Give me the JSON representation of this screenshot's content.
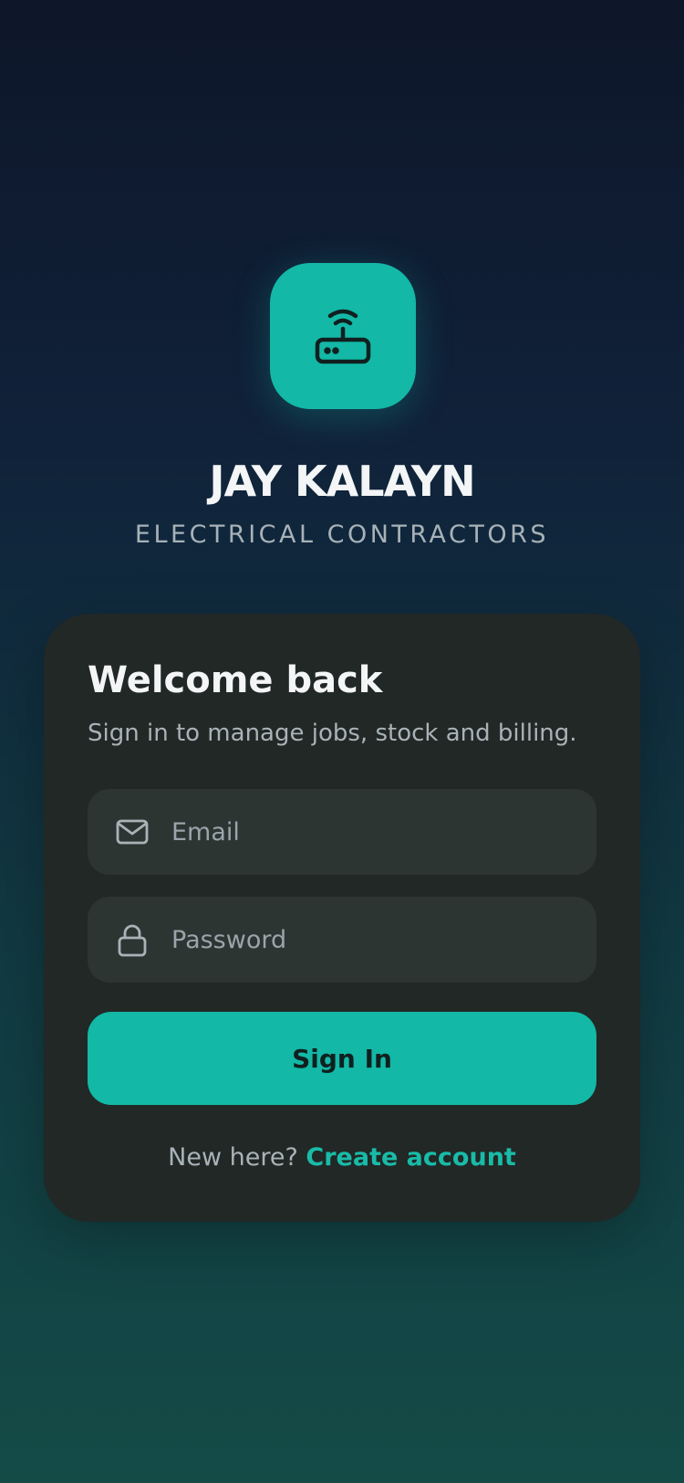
{
  "brand": {
    "logo_icon": "router-icon",
    "accent_color": "#13b8a6",
    "title": "JAY KALAYN",
    "subtitle": "ELECTRICAL CONTRACTORS"
  },
  "card": {
    "title": "Welcome back",
    "subtitle": "Sign in to manage jobs, stock and billing.",
    "email": {
      "icon": "mail-icon",
      "placeholder": "Email",
      "value": ""
    },
    "password": {
      "icon": "lock-icon",
      "placeholder": "Password",
      "value": ""
    },
    "signin_label": "Sign In",
    "footer_prompt": "New here?",
    "create_account_label": "Create account"
  }
}
